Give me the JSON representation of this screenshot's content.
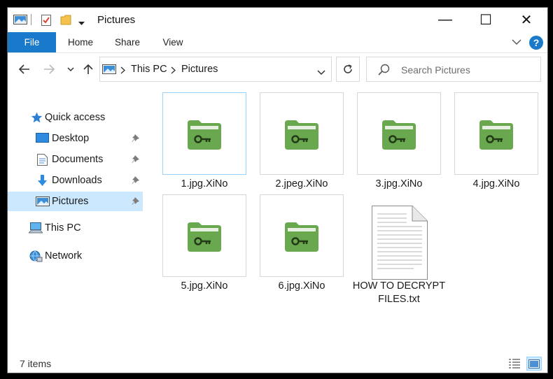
{
  "window": {
    "title": "Pictures",
    "controls": {
      "minimize": "—",
      "maximize": "☐",
      "close": "✕"
    }
  },
  "ribbon": {
    "tabs": [
      "File",
      "Home",
      "Share",
      "View"
    ],
    "help": "?"
  },
  "address": {
    "breadcrumbs": [
      "This PC",
      "Pictures"
    ],
    "search_placeholder": "Search Pictures"
  },
  "nav": {
    "quick_access": "Quick access",
    "items": [
      {
        "label": "Desktop",
        "icon": "desktop-icon",
        "pinned": true
      },
      {
        "label": "Documents",
        "icon": "documents-icon",
        "pinned": true
      },
      {
        "label": "Downloads",
        "icon": "downloads-icon",
        "pinned": true
      },
      {
        "label": "Pictures",
        "icon": "pictures-icon",
        "pinned": true,
        "selected": true
      }
    ],
    "this_pc": "This PC",
    "network": "Network"
  },
  "files": [
    {
      "name": "1.jpg.XiNo",
      "icon": "encrypted-folder-icon",
      "selected": true
    },
    {
      "name": "2.jpeg.XiNo",
      "icon": "encrypted-folder-icon"
    },
    {
      "name": "3.jpg.XiNo",
      "icon": "encrypted-folder-icon"
    },
    {
      "name": "4.jpg.XiNo",
      "icon": "encrypted-folder-icon"
    },
    {
      "name": "5.jpg.XiNo",
      "icon": "encrypted-folder-icon"
    },
    {
      "name": "6.jpg.XiNo",
      "icon": "encrypted-folder-icon"
    },
    {
      "name": "HOW TO DECRYPT FILES.txt",
      "icon": "text-document-icon"
    }
  ],
  "status": {
    "items": "7 items"
  },
  "colors": {
    "accent": "#1979ca",
    "selection": "#cce8ff",
    "folder": "#6aa84f",
    "folder_dark": "#4f8a3a"
  }
}
